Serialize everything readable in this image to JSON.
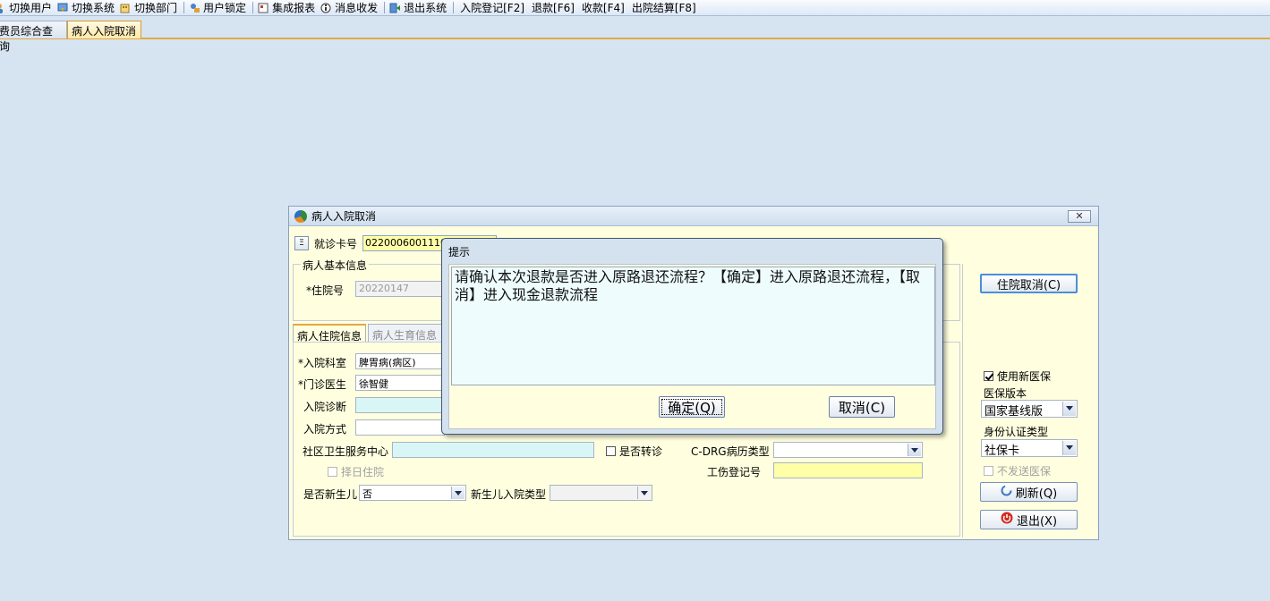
{
  "toolbar": {
    "items": [
      {
        "label": "切换用户",
        "icon": "switch-user-icon"
      },
      {
        "label": "切换系统",
        "icon": "switch-system-icon"
      },
      {
        "label": "切换部门",
        "icon": "switch-department-icon"
      },
      {
        "label": "用户锁定",
        "icon": "user-lock-icon"
      },
      {
        "label": "集成报表",
        "icon": "report-icon"
      },
      {
        "label": "消息收发",
        "icon": "message-icon"
      },
      {
        "label": "退出系统",
        "icon": "exit-system-icon"
      }
    ],
    "shortcuts": [
      "入院登记[F2]",
      "退款[F6]",
      "收款[F4]",
      "出院结算[F8]"
    ]
  },
  "doc_tabs": [
    "费员综合查询",
    "病人入院取消"
  ],
  "window": {
    "title": "病人入院取消",
    "close_label": "✕",
    "card_label": "就诊卡号",
    "card_value": "022000600111033",
    "basic_group_label": "病人基本信息",
    "admission_no_label": "*住院号",
    "admission_no_value": "20220147",
    "tabs": [
      "病人住院信息",
      "病人生育信息"
    ],
    "fields": {
      "dept_label": "*入院科室",
      "dept_value": "脾胃病(病区)",
      "doctor_label": "*门诊医生",
      "doctor_value": "徐智健",
      "diagnosis_label": "入院诊断",
      "method_label": "入院方式",
      "community_label": "社区卫生服务中心",
      "transfer_label": "是否转诊",
      "select_day_label": "择日住院",
      "newborn_label": "是否新生儿",
      "newborn_value": "否",
      "newborn_type_label": "新生儿入院类型",
      "cdrg_label": "C-DRG病历类型",
      "injury_label": "工伤登记号"
    },
    "right": {
      "cancel_admission_button": "住院取消(C)",
      "use_new_insurance_label": "使用新医保",
      "insurance_version_label": "医保版本",
      "insurance_version_value": "国家基线版",
      "auth_type_label": "身份认证类型",
      "auth_type_value": "社保卡",
      "no_send_label": "不发送医保",
      "refresh_button": "刷新(Q)",
      "exit_button": "退出(X)"
    }
  },
  "dialog": {
    "title": "提示",
    "message": "请确认本次退款是否进入原路退还流程？【确定】进入原路退还流程，【取消】进入现金退款流程",
    "ok_button": "确定(Q)",
    "cancel_button": "取消(C)"
  }
}
